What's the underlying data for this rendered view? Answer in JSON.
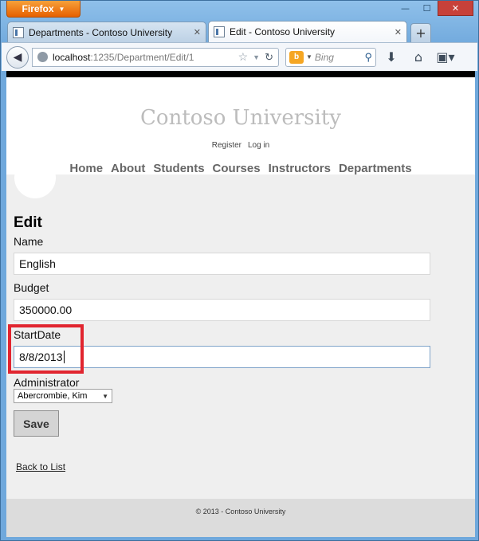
{
  "browser": {
    "app_button": "Firefox",
    "tabs": [
      {
        "title": "Departments - Contoso University",
        "close": "✕"
      },
      {
        "title": "Edit - Contoso University",
        "close": "✕"
      }
    ],
    "new_tab": "+",
    "url_host": "localhost",
    "url_rest": ":1235/Department/Edit/1",
    "search_placeholder": "Bing",
    "window_controls": {
      "minimize": "—",
      "maximize": "☐",
      "close": "✕"
    }
  },
  "site": {
    "title": "Contoso University",
    "login_links": [
      "Register",
      "Log in"
    ],
    "menu": [
      "Home",
      "About",
      "Students",
      "Courses",
      "Instructors",
      "Departments"
    ]
  },
  "form": {
    "heading": "Edit",
    "name_label": "Name",
    "name_value": "English",
    "budget_label": "Budget",
    "budget_value": "350000.00",
    "startdate_label": "StartDate",
    "startdate_value": "8/8/2013",
    "administrator_label": "Administrator",
    "administrator_value": "Abercrombie, Kim",
    "save_label": "Save",
    "back_link": "Back to List"
  },
  "footer": {
    "text": "© 2013 - Contoso University"
  },
  "colors": {
    "accent_highlight": "#e1252f",
    "firefox_orange": "#e66000"
  }
}
